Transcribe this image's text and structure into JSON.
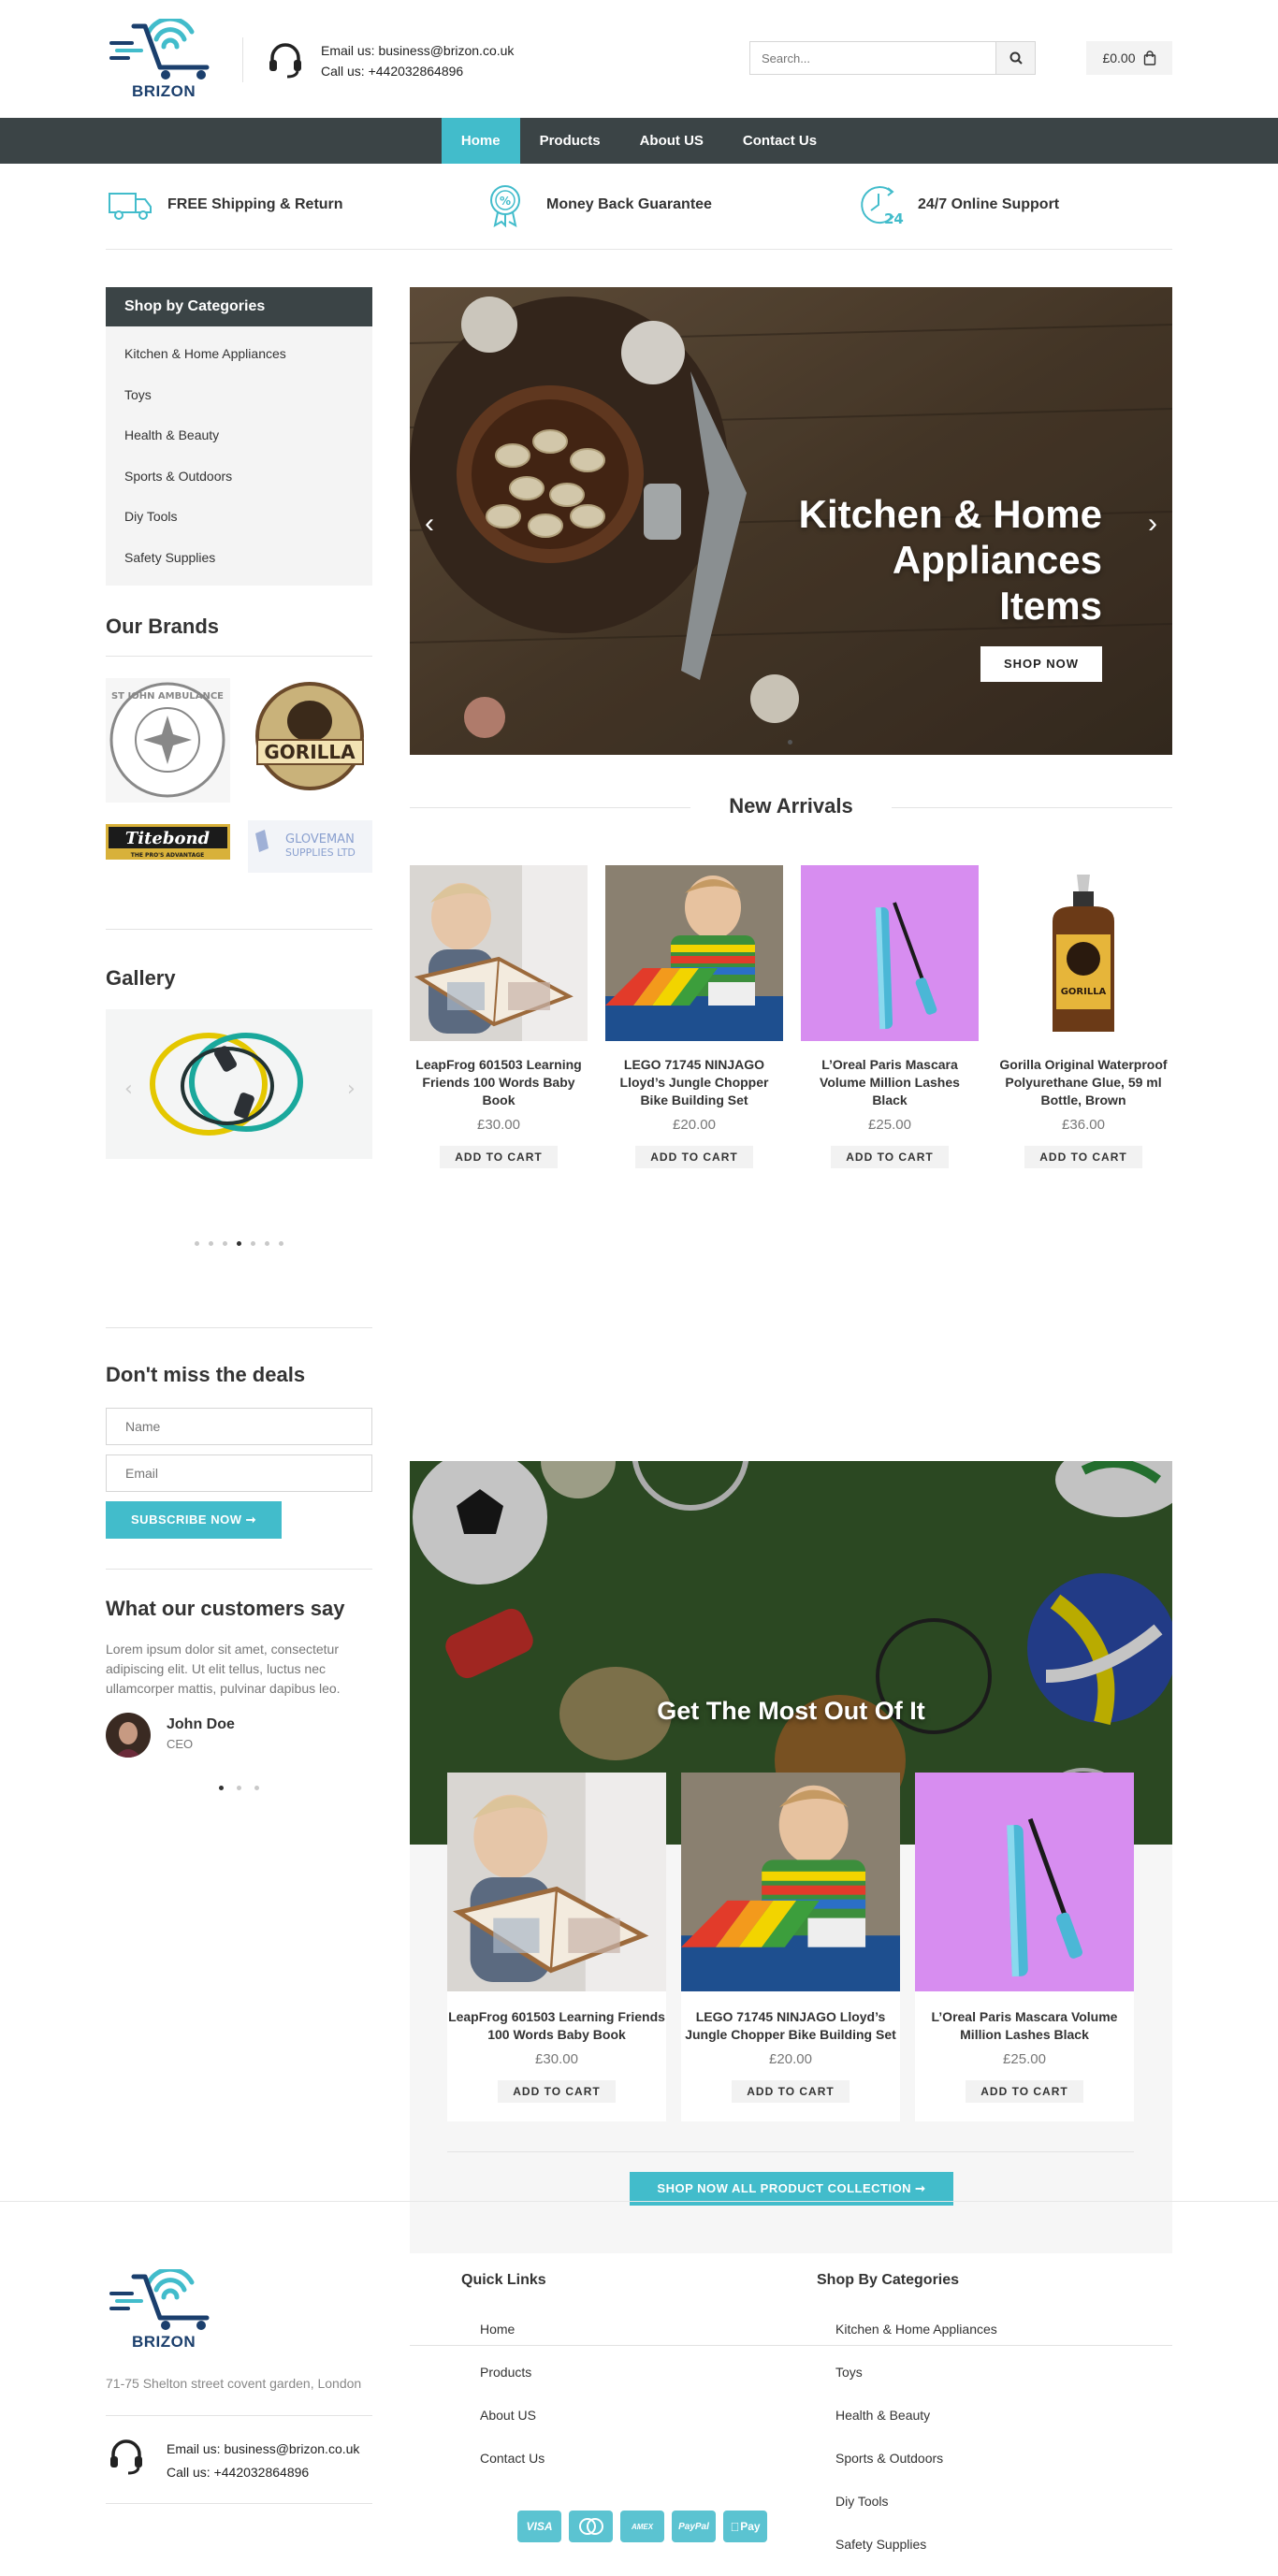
{
  "header": {
    "logo_text": "BRIZON",
    "email": "Email us: business@brizon.co.uk",
    "phone": "Call us: +442032864896",
    "search_placeholder": "Search...",
    "cart_total": "£0.00"
  },
  "nav": {
    "items": [
      {
        "label": "Home"
      },
      {
        "label": "Products"
      },
      {
        "label": "About US"
      },
      {
        "label": "Contact Us"
      }
    ]
  },
  "features": [
    {
      "label": "FREE Shipping & Return",
      "icon": "truck-icon"
    },
    {
      "label": "Money Back Guarantee",
      "icon": "badge-percent-icon"
    },
    {
      "label": "24/7 Online Support",
      "icon": "clock-24-icon"
    }
  ],
  "sidebar": {
    "categories_title": "Shop by Categories",
    "categories": [
      "Kitchen & Home Appliances",
      "Toys",
      "Health & Beauty",
      "Sports & Outdoors",
      "Diy Tools",
      "Safety Supplies"
    ],
    "brands_title": "Our Brands",
    "brands": {
      "ambulance_text": "ST JOHN AMBULANCE",
      "gorilla_text": "GORILLA",
      "titebond_text": "Titebond",
      "titebond_tag": "THE PRO'S ADVANTAGE",
      "gloveman_line1": "GLOVEMAN",
      "gloveman_line2": "SUPPLIES LTD"
    },
    "gallery_title": "Gallery",
    "deals_title": "Don't miss the deals",
    "name_placeholder": "Name",
    "email_placeholder": "Email",
    "subscribe_label": "SUBSCRIBE NOW ➞",
    "testimonial_title": "What our customers say",
    "testimonial_text": "Lorem ipsum dolor sit amet, consectetur adipiscing elit. Ut elit tellus, luctus nec ullamcorper mattis, pulvinar dapibus leo.",
    "testimonial_name": "John Doe",
    "testimonial_role": "CEO"
  },
  "hero": {
    "title_line1": "Kitchen & Home",
    "title_line2": "Appliances",
    "title_line3": "Items",
    "button": "SHOP NOW"
  },
  "new_arrivals": {
    "title": "New Arrivals",
    "products": [
      {
        "name": "LeapFrog 601503 Learning Friends 100 Words Baby Book",
        "price": "£30.00",
        "cta": "ADD TO CART"
      },
      {
        "name": "LEGO 71745 NINJAGO Lloyd’s Jungle Chopper Bike Building Set",
        "price": "£20.00",
        "cta": "ADD TO CART"
      },
      {
        "name": "L’Oreal Paris Mascara Volume Million Lashes Black",
        "price": "£25.00",
        "cta": "ADD TO CART"
      },
      {
        "name": "Gorilla Original Waterproof Polyurethane Glue, 59 ml Bottle, Brown",
        "price": "£36.00",
        "cta": "ADD TO CART"
      }
    ]
  },
  "promo": {
    "title": "Get The Most Out Of It",
    "products": [
      {
        "name": "LeapFrog 601503 Learning Friends 100 Words Baby Book",
        "price": "£30.00",
        "cta": "ADD TO CART"
      },
      {
        "name": "LEGO 71745 NINJAGO Lloyd’s Jungle Chopper Bike Building Set",
        "price": "£20.00",
        "cta": "ADD TO CART"
      },
      {
        "name": "L’Oreal Paris Mascara Volume Million Lashes Black",
        "price": "£25.00",
        "cta": "ADD TO CART"
      }
    ],
    "shop_all": "SHOP NOW ALL PRODUCT COLLECTION ➞"
  },
  "footer": {
    "logo_text": "BRIZON",
    "address": "71-75 Shelton street covent garden, London",
    "email": "Email us: business@brizon.co.uk",
    "phone": "Call us: +442032864896",
    "quick_links_title": "Quick Links",
    "quick_links": [
      "Home",
      "Products",
      "About US",
      "Contact Us"
    ],
    "categories_title": "Shop By Categories",
    "categories": [
      "Kitchen & Home Appliances",
      "Toys",
      "Health & Beauty",
      "Sports & Outdoors",
      "Diy Tools",
      "Safety Supplies"
    ],
    "payments": [
      "VISA",
      "MC",
      "AMEX",
      "PayPal",
      "Pay"
    ]
  },
  "colors": {
    "accent": "#42bccb",
    "dark": "#3b4446",
    "brand_blue": "#1b3f6d"
  }
}
